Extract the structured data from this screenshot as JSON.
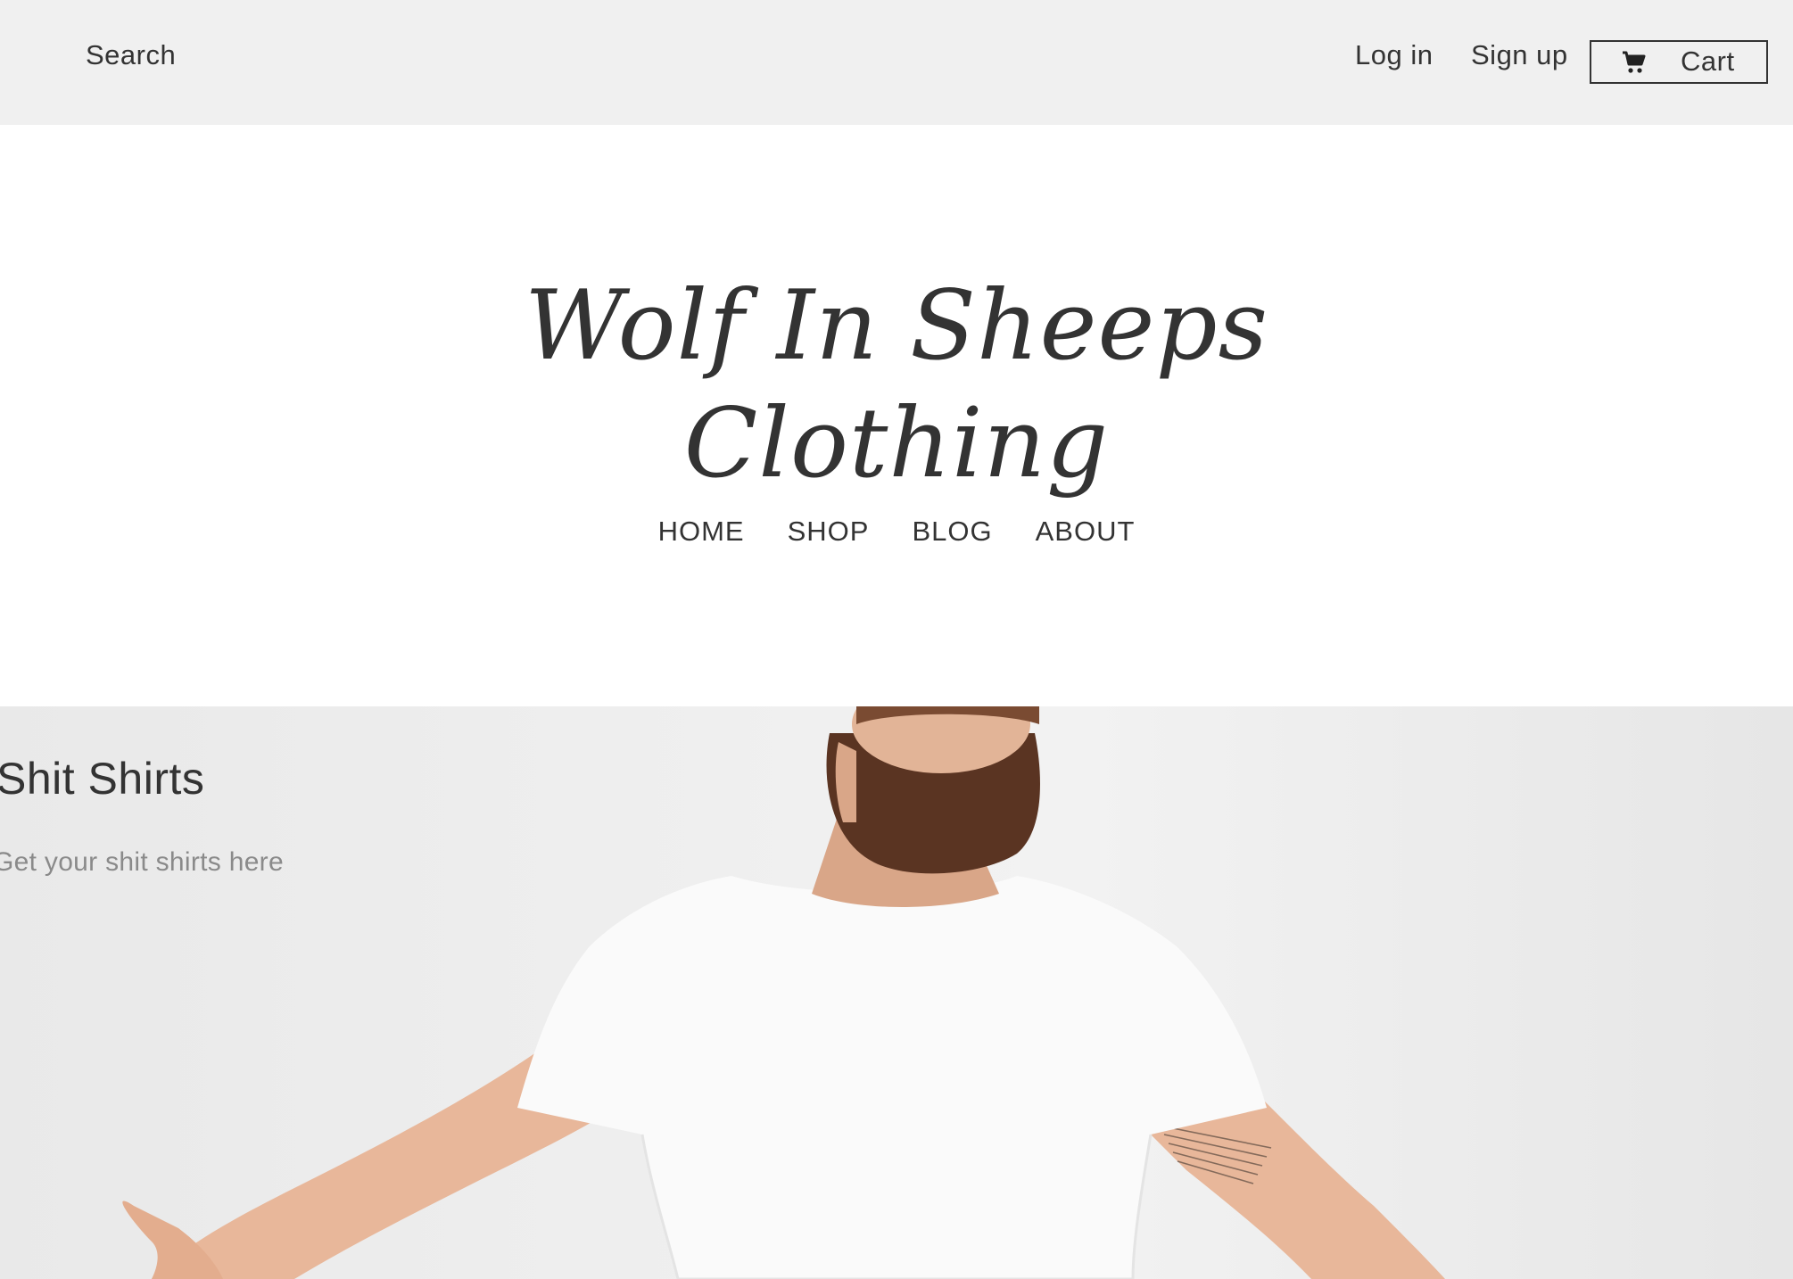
{
  "topbar": {
    "search_label": "Search",
    "login_label": "Log in",
    "signup_label": "Sign up",
    "cart_label": "Cart",
    "cart_icon": "shopping-cart-icon"
  },
  "header": {
    "logo_line1": "Wolf In Sheeps",
    "logo_line2": "Clothing"
  },
  "nav": {
    "items": [
      "HOME",
      "SHOP",
      "BLOG",
      "ABOUT"
    ]
  },
  "hero": {
    "title": "Shit Shirts",
    "subtitle": "Get your shit shirts here"
  },
  "colors": {
    "topbar_bg": "#f0f0f0",
    "text": "#333333",
    "subtitle": "#8a8a8a",
    "hero_bg": "#ececec"
  }
}
